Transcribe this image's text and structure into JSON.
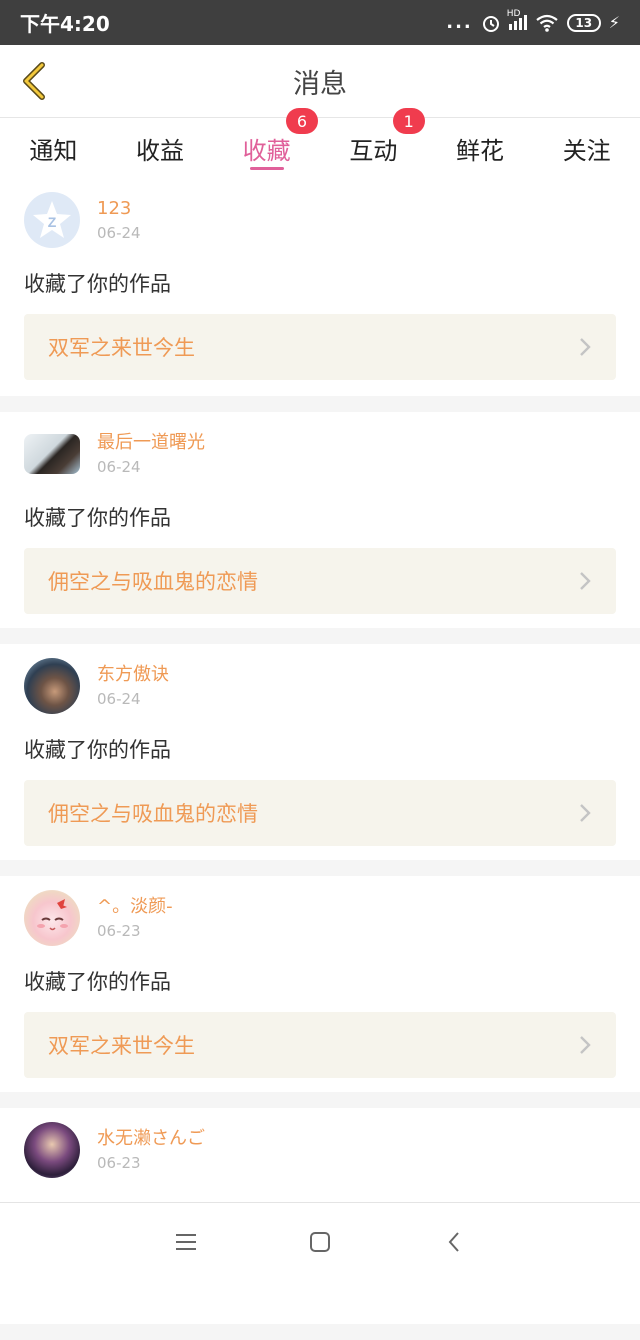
{
  "status_bar": {
    "time": "下午4:20",
    "dots": "...",
    "hd_label": "HD",
    "battery": "13",
    "icons": [
      "alarm-icon",
      "signal-icon",
      "wifi-icon",
      "battery-icon",
      "charging-icon"
    ]
  },
  "header": {
    "title": "消息",
    "back_icon": "chevron-left-icon"
  },
  "tabs": [
    {
      "label": "通知",
      "badge": null,
      "active": false
    },
    {
      "label": "收益",
      "badge": null,
      "active": false
    },
    {
      "label": "收藏",
      "badge": "6",
      "active": true
    },
    {
      "label": "互动",
      "badge": "1",
      "active": false
    },
    {
      "label": "鲜花",
      "badge": null,
      "active": false
    },
    {
      "label": "关注",
      "badge": null,
      "active": false
    }
  ],
  "items": [
    {
      "name": "123",
      "date": "06-24",
      "action": "收藏了你的作品",
      "work": "双军之来世今生"
    },
    {
      "name": "最后一道曙光",
      "date": "06-24",
      "action": "收藏了你的作品",
      "work": "佣空之与吸血鬼的恋情"
    },
    {
      "name": "东方傲诀",
      "date": "06-24",
      "action": "收藏了你的作品",
      "work": "佣空之与吸血鬼的恋情"
    },
    {
      "name": "^。淡颜-",
      "date": "06-23",
      "action": "收藏了你的作品",
      "work": "双军之来世今生"
    },
    {
      "name": "水无濑さんご",
      "date": "06-23",
      "action": "",
      "work": ""
    }
  ],
  "colors": {
    "accent_pink": "#e0609a",
    "name_orange": "#ef9a55",
    "badge_red": "#f03c4e",
    "work_bg": "#f6f4ec"
  }
}
